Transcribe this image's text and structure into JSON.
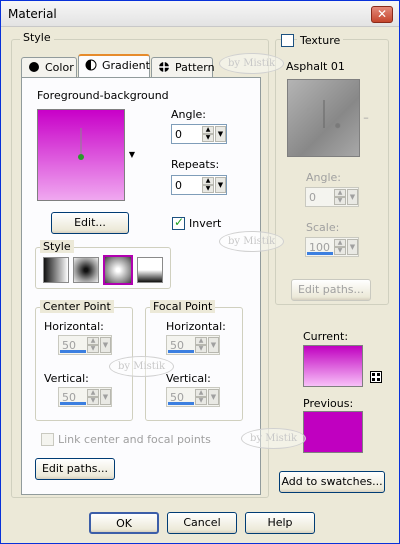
{
  "window": {
    "title": "Material",
    "close_label": "✕"
  },
  "style_group": {
    "label": "Style"
  },
  "tabs": [
    {
      "label": "Color",
      "icon": "circle-icon"
    },
    {
      "label": "Gradient",
      "icon": "half-circle-icon"
    },
    {
      "label": "Pattern",
      "icon": "crosshair-icon"
    }
  ],
  "gradient": {
    "name": "Foreground-background",
    "colors": {
      "start": "#c800c8",
      "end": "#f0a0f0"
    },
    "edit_label": "Edit...",
    "angle_label": "Angle:",
    "angle_value": "0",
    "repeats_label": "Repeats:",
    "repeats_value": "0",
    "invert_label": "Invert",
    "invert_checked": true,
    "style_label": "Style",
    "center_point": {
      "label": "Center Point",
      "horizontal_label": "Horizontal:",
      "horizontal_value": "50",
      "vertical_label": "Vertical:",
      "vertical_value": "50"
    },
    "focal_point": {
      "label": "Focal Point",
      "horizontal_label": "Horizontal:",
      "horizontal_value": "50",
      "vertical_label": "Vertical:",
      "vertical_value": "50"
    },
    "link_label": "Link center and focal points",
    "edit_paths_label": "Edit paths..."
  },
  "texture": {
    "label": "Texture",
    "checked": false,
    "name": "Asphalt 01",
    "angle_label": "Angle:",
    "angle_value": "0",
    "scale_label": "Scale:",
    "scale_value": "100",
    "edit_paths_label": "Edit paths..."
  },
  "swatches": {
    "current_label": "Current:",
    "current_color": "#c000c0",
    "previous_label": "Previous:",
    "previous_color": "#c000c0",
    "add_label": "Add to swatches..."
  },
  "buttons": {
    "ok": "OK",
    "cancel": "Cancel",
    "help": "Help"
  },
  "watermark_text": "by Mistik"
}
